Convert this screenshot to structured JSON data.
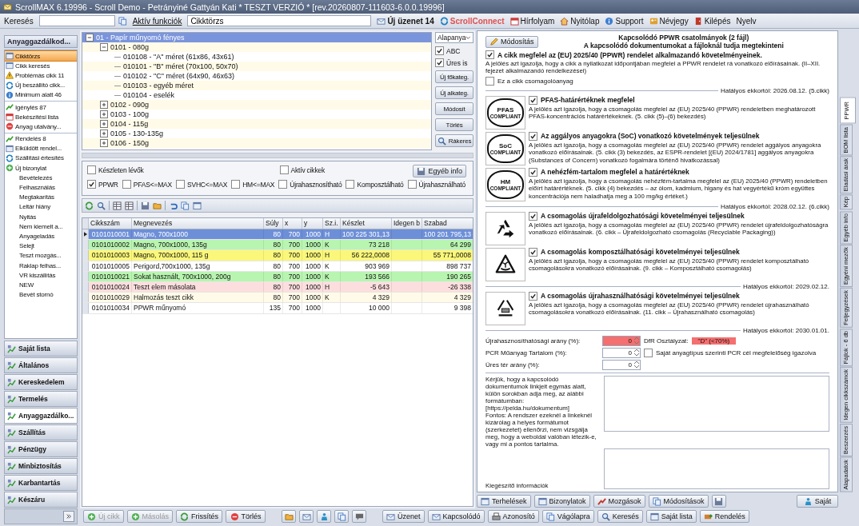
{
  "window": {
    "title": "ScrollMAX 6.19996 - Scroll Demo - Petrányiné Gattyán Kati * TESZT VERZIÓ * [rev.20260807-111603-6.0.0.19996]"
  },
  "toolbar": {
    "search_label": "Keresés",
    "functions_label": "Aktív funkciók",
    "functions_value": "Cikktörzs",
    "links": [
      {
        "label": "Új üzenet 14",
        "kind": "message"
      },
      {
        "label": "ScrollConnect",
        "kind": "connect"
      },
      {
        "label": "Hírfolyam",
        "kind": "news"
      },
      {
        "label": "Nyitólap",
        "kind": "home"
      },
      {
        "label": "Support",
        "kind": "help"
      },
      {
        "label": "Névjegy",
        "kind": "card"
      },
      {
        "label": "Kilépés",
        "kind": "exit"
      },
      {
        "label": "Nyelv",
        "kind": "plain"
      }
    ]
  },
  "sidebar": {
    "header": "Anyaggazdálkod...",
    "groups": [
      [
        {
          "label": "Cikktörzs",
          "selected": true
        },
        {
          "label": "Cikk keresés",
          "selected": false
        },
        {
          "label": "Problémás cikk 11",
          "selected": false
        },
        {
          "label": "Új beszállító cikk...",
          "selected": false
        },
        {
          "label": "Minimum alatt 46",
          "selected": false
        }
      ],
      [
        {
          "label": "Igénylés 87",
          "selected": false
        },
        {
          "label": "Bekészítési lista",
          "selected": false
        },
        {
          "label": "Anyag utalvány...",
          "selected": false
        }
      ],
      [
        {
          "label": "Rendelés 8",
          "selected": false
        },
        {
          "label": "Elküldött rendel...",
          "selected": false
        },
        {
          "label": "Szállítási értesítés",
          "selected": false
        },
        {
          "label": "Új bizonylat",
          "selected": false,
          "children": [
            {
              "label": "Bevételezés",
              "selected": false
            },
            {
              "label": "Felhasználás",
              "selected": false
            },
            {
              "label": "Megtakarítás",
              "selected": false
            },
            {
              "label": "Leltár hiány",
              "selected": false
            },
            {
              "label": "Nyitás",
              "selected": false
            },
            {
              "label": "Nem kiemelt a...",
              "selected": false
            },
            {
              "label": "Anyageladás",
              "selected": false
            },
            {
              "label": "Selejt",
              "selected": false
            },
            {
              "label": "Teszt mozgás...",
              "selected": false
            },
            {
              "label": "Raklap felhas...",
              "selected": false
            },
            {
              "label": "VR kiszállítás",
              "selected": false
            },
            {
              "label": "NEW",
              "selected": false
            },
            {
              "label": "Bevét stornó",
              "selected": false
            }
          ]
        }
      ]
    ],
    "sections": [
      {
        "label": "Saját lista",
        "selected": false
      },
      {
        "label": "Általános",
        "selected": false
      },
      {
        "label": "Kereskedelem",
        "selected": false
      },
      {
        "label": "Termelés",
        "selected": false
      },
      {
        "label": "Anyaggazdálko...",
        "selected": true
      },
      {
        "label": "Szállítás",
        "selected": false
      },
      {
        "label": "Pénzügy",
        "selected": false
      },
      {
        "label": "Minbiztosítás",
        "selected": false
      },
      {
        "label": "Karbantartás",
        "selected": false
      },
      {
        "label": "Készáru",
        "selected": false
      }
    ]
  },
  "tree": {
    "nodes": [
      {
        "label": "01 - Papír műnyomó fényes",
        "expanded": true,
        "selected": true,
        "children": [
          {
            "label": "0101 - 080g",
            "expanded": true,
            "selected": false,
            "children": [
              {
                "label": "010108 - \"A\" méret (61x86, 43x61)",
                "selected": false
              },
              {
                "label": "010101 - \"B\" méret (70x100, 50x70)",
                "selected": false
              },
              {
                "label": "010102 - \"C\" méret (64x90, 46x63)",
                "selected": false
              },
              {
                "label": "010103 - egyéb méret",
                "selected": false
              },
              {
                "label": "010104 - eselék",
                "selected": false
              }
            ]
          },
          {
            "label": "0102 - 090g",
            "expanded": false,
            "selected": false
          },
          {
            "label": "0103 - 100g",
            "expanded": false,
            "selected": false
          },
          {
            "label": "0104 - 115g",
            "expanded": false,
            "selected": false
          },
          {
            "label": "0105 - 130-135g",
            "expanded": false,
            "selected": false
          },
          {
            "label": "0106 - 150g",
            "expanded": false,
            "selected": false
          }
        ]
      }
    ],
    "dropdown": "Alapanya",
    "options": [
      {
        "label": "ABC",
        "checked": true
      },
      {
        "label": "Üres is",
        "checked": true
      }
    ],
    "buttons": [
      "Új főkateg.",
      "Új alkateg.",
      "Módosít",
      "Törlés",
      "Rákeres"
    ]
  },
  "filters": {
    "row_1": [
      {
        "label": "Készleten lévők",
        "checked": false
      },
      {
        "label": "Aktív cikkek",
        "checked": false
      }
    ],
    "row_2": [
      {
        "label": "PPWR",
        "checked": true
      },
      {
        "label": "PFAS<=MAX",
        "checked": false
      },
      {
        "label": "SVHC<=MAX",
        "checked": false
      },
      {
        "label": "HM<=MAX",
        "checked": false
      },
      {
        "label": "Újrahasznosítható",
        "checked": false
      },
      {
        "label": "Komposztálható",
        "checked": false
      },
      {
        "label": "Újrahasználható",
        "checked": false
      }
    ],
    "button": "Egyéb info"
  },
  "table": {
    "columns": [
      "Cikkszám",
      "Megnevezés",
      "Súly",
      "x",
      "y",
      "Sz.i.",
      "Készlet",
      "Idegen b",
      "Szabad"
    ],
    "rows": [
      {
        "selected": true,
        "color": "#6d8fd8",
        "cells": [
          "0101010001",
          "Magno, 700x1000",
          "80",
          "700",
          "1000",
          "H",
          "100 225 301,13",
          "",
          "100 201 795,13"
        ]
      },
      {
        "selected": false,
        "color": "#b8f5b0",
        "cells": [
          "0101010002",
          "Magno, 700x1000, 135g",
          "80",
          "700",
          "1000",
          "K",
          "73 218",
          "",
          "64 299"
        ]
      },
      {
        "selected": false,
        "color": "#fbf77a",
        "cells": [
          "0101010003",
          "Magno, 700x1000, 115 g",
          "80",
          "700",
          "1000",
          "H",
          "56 222,0008",
          "",
          "55 771,0008"
        ]
      },
      {
        "selected": false,
        "color": "#ffffff",
        "cells": [
          "0101010005",
          "Perigord,700x1000, 135g",
          "80",
          "700",
          "1000",
          "K",
          "903 969",
          "",
          "898 737"
        ]
      },
      {
        "selected": false,
        "color": "#b8f5b0",
        "cells": [
          "0101010021",
          "Sokat használt, 700x1000, 200g",
          "80",
          "700",
          "1000",
          "K",
          "193 566",
          "",
          "190 265"
        ]
      },
      {
        "selected": false,
        "color": "#fcdede",
        "cells": [
          "0101010024",
          "Teszt elem másolata",
          "80",
          "700",
          "1000",
          "H",
          "-5 643",
          "",
          "-26 338"
        ]
      },
      {
        "selected": false,
        "color": "#fffbe8",
        "cells": [
          "0101010029",
          "Halmozás teszt cikk",
          "80",
          "700",
          "1000",
          "K",
          "4 329",
          "",
          "4 329"
        ]
      },
      {
        "selected": false,
        "color": "#ffffff",
        "cells": [
          "0101010034",
          "PPWR műnyomó",
          "135",
          "700",
          "1000",
          "",
          "10 000",
          "",
          "9 398"
        ]
      }
    ]
  },
  "ppwr": {
    "edit_button": "Módosítás",
    "title": "Kapcsolódó PPWR csatolmányok (2 fájl)",
    "subtitle": "A kapcsolódó dokumentumokat a fájloknál tudja megtekinteni",
    "main": {
      "checked": true,
      "label": "A cikk megfelel az (EU) 2025/40 (PPWR) rendelet alkalmazandó követelményeinek.",
      "description": "A jelölés azt igazolja, hogy a cikk a nyilatkozat időpontjában megfelel a PPWR rendelet rá vonatkozó előírásainak. (II–XII. fejezet alkalmazandó rendelkezései)"
    },
    "packaging": {
      "checked": false,
      "label": "Ez a cikk csomagolóanyag"
    },
    "blocks": [
      {
        "kind": "date",
        "label": "Hatályos ekkortól: 2026.08.12. (5.cikk)"
      },
      {
        "kind": "requirement",
        "badge_label": "PFAS",
        "badge_caption": "COMPLIANT",
        "checked": true,
        "title": "PFAS-határértéknek megfelel",
        "description": "A jelölés azt igazolja, hogy a csomagolás megfelel az (EU) 2025/40 (PPWR) rendeletben meghatározott PFAS-koncentrációs határértékeknek. (5. cikk (5)–(6) bekezdés)"
      },
      {
        "kind": "requirement",
        "badge_label": "SoC",
        "badge_caption": "COMPLIANT",
        "checked": true,
        "title": "Az aggályos anyagokra (SoC) vonatkozó követelmények teljesülnek",
        "description": "A jelölés azt igazolja, hogy a csomagolás megfelel az (EU) 2025/40 (PPWR) rendelet aggályos anyagokra vonatkozó előírásainak. (5. cikk (3) bekezdés, az ESPR-rendelet [(EU) 2024/1781] aggályos anyagokra (Substances of Concern) vonatkozó fogalmára történő hivatkozással)"
      },
      {
        "kind": "requirement",
        "badge_label": "HM",
        "badge_caption": "COMPLIANT",
        "checked": true,
        "title": "A nehézfém-tartalom megfelel a határértéknek",
        "description": "A jelölés azt igazolja, hogy a csomagolás nehézfém-tartalma megfelel az (EU) 2025/40 (PPWR) rendeletben előírt határértéknek. (5. cikk (4) bekezdés – az ólom, kadmium, higany és hat vegyértékű króm együttes koncentrációja nem haladhatja meg a 100 mg/kg értéket.)"
      },
      {
        "kind": "date",
        "label": "Hatályos ekkortól: 2028.02.12. (6.cikk)"
      },
      {
        "kind": "requirement",
        "checked": true,
        "title": "A csomagolás újrafeldolgozhatósági követelményei teljesülnek",
        "description": "A jelölés azt igazolja, hogy a csomagolás megfelel az (EU) 2025/40 (PPWR) rendelet újrafeldolgozhatóságra vonatkozó előírásainak. (6. cikk – Újrafeldolgozható csomagolás (Recyclable Packaging))"
      },
      {
        "kind": "requirement",
        "checked": true,
        "title": "A csomagolás komposztálhatósági követelményei teljesülnek",
        "description": "A jelölés azt igazolja, hogy a csomagolás megfelel az (EU) 2025/40 (PPWR) rendelet komposztálható csomagolásokra vonatkozó előírásainak. (9. cikk – Komposztálható csomagolás)"
      },
      {
        "kind": "date",
        "label": "Hatályos ekkortól: 2029.02.12."
      },
      {
        "kind": "requirement",
        "checked": true,
        "title": "A csomagolás újrahasználhatósági követelményei teljesülnek",
        "description": "A jelölés azt igazolja, hogy a csomagolás megfelel az (EU) 2025/40 (PPWR) rendelet újrahasználható csomagolásokra vonatkozó előírásainak. (11. cikk – Újrahasználható csomagolás)"
      },
      {
        "kind": "date",
        "label": "Hatályos ekkortól: 2030.01.01."
      }
    ],
    "fields": [
      {
        "label": "Újrahasznosíthatósági arány (%):",
        "value": "0",
        "invalid": true,
        "grade_label": "DfR Osztályzat:",
        "grade_value": "\"D\" (<70%)"
      },
      {
        "label": "PCR Műanyag Tartalom (%):",
        "value": "0",
        "invalid": false,
        "check_label": "Saját anyagtípus szerinti PCR cél megfelelőség igazolva",
        "checked": false
      },
      {
        "label": "Üres tér arány (%):",
        "value": "0",
        "invalid": false
      }
    ],
    "instructions": [
      "Kérjük, hogy a kapcsolódó dokumentumok linkjeit egymás alatt, külön sorokban adja meg, az alábbi formátumban:",
      "[https://pelda.hu/dokumentum]",
      "Fontos: A rendszer ezeknél a linkeknél kizárólag a helyes formátumot (szerkezetet) ellenőrzi, nem vizsgálja meg, hogy a weboldal valóban létezik-e, vagy mi a pontos tartalma."
    ],
    "extra_label": "Kiegészítő információk",
    "buttons": [
      "Terhelések",
      "Bizonylatok",
      "Mozgások",
      "Módosítások"
    ],
    "right_button": "Saját"
  },
  "side_tabs": [
    {
      "label": "PPWR",
      "selected": true
    },
    {
      "label": "BOM lista",
      "selected": false
    },
    {
      "label": "Eladási árak",
      "selected": false
    },
    {
      "label": "Kép",
      "selected": false
    },
    {
      "label": "Egyéb info",
      "selected": false
    },
    {
      "label": "Egyéni mezők",
      "selected": false
    },
    {
      "label": "Feljegyzések",
      "selected": false
    },
    {
      "label": "Fájlok - 6 db",
      "selected": false
    },
    {
      "label": "Idegen cikkszámok",
      "selected": false
    },
    {
      "label": "Beszerzés",
      "selected": false
    },
    {
      "label": "Alapadatok",
      "selected": false
    }
  ],
  "bottom_bar": {
    "left": [
      {
        "label": "Új cikk",
        "disabled": true
      },
      {
        "label": "Másolás",
        "disabled": true
      },
      {
        "label": "Frissítés",
        "disabled": false
      },
      {
        "label": "Törlés",
        "disabled": false
      }
    ],
    "right": [
      "Üzenet",
      "Kapcsolódó",
      "Azonosító",
      "Vágólapra",
      "Keresés",
      "Saját lista",
      "Rendelés"
    ]
  }
}
